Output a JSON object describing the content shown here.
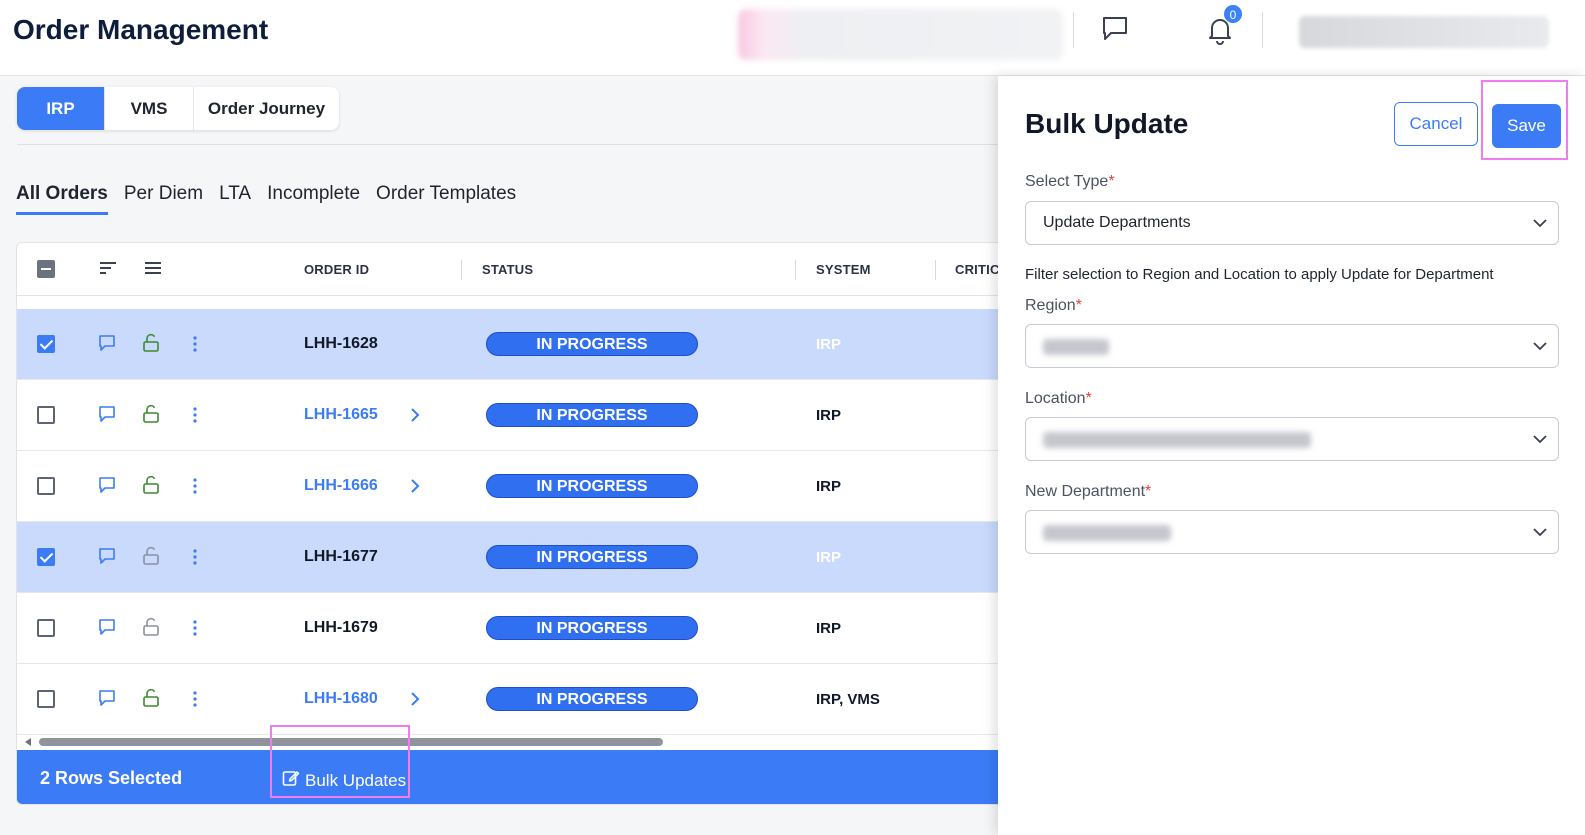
{
  "header": {
    "title": "Order Management",
    "notification_count": "0"
  },
  "segment_tabs": [
    {
      "label": "IRP",
      "active": true
    },
    {
      "label": "VMS",
      "active": false
    },
    {
      "label": "Order Journey",
      "active": false
    }
  ],
  "sub_tabs": [
    {
      "label": "All Orders",
      "active": true
    },
    {
      "label": "Per Diem",
      "active": false
    },
    {
      "label": "LTA",
      "active": false
    },
    {
      "label": "Incomplete",
      "active": false
    },
    {
      "label": "Order Templates",
      "active": false
    }
  ],
  "grid": {
    "columns": [
      "ORDER ID",
      "STATUS",
      "SYSTEM",
      "CRITIC."
    ],
    "rows": [
      {
        "order_id": "LHH-1628",
        "status": "IN PROGRESS",
        "system": "IRP",
        "selected": true,
        "link": false
      },
      {
        "order_id": "LHH-1665",
        "status": "IN PROGRESS",
        "system": "IRP",
        "selected": false,
        "link": true
      },
      {
        "order_id": "LHH-1666",
        "status": "IN PROGRESS",
        "system": "IRP",
        "selected": false,
        "link": true
      },
      {
        "order_id": "LHH-1677",
        "status": "IN PROGRESS",
        "system": "IRP",
        "selected": true,
        "link": false
      },
      {
        "order_id": "LHH-1679",
        "status": "IN PROGRESS",
        "system": "IRP",
        "selected": false,
        "link": false
      },
      {
        "order_id": "LHH-1680",
        "status": "IN PROGRESS",
        "system": "IRP, VMS",
        "selected": false,
        "link": true
      }
    ]
  },
  "footer": {
    "rows_selected": "2 Rows Selected",
    "bulk_updates": "Bulk Updates"
  },
  "panel": {
    "title": "Bulk Update",
    "cancel": "Cancel",
    "save": "Save",
    "select_type_label": "Select Type",
    "select_type_value": "Update Departments",
    "hint": "Filter selection to Region and Location to apply Update for Department",
    "region_label": "Region",
    "location_label": "Location",
    "new_department_label": "New Department",
    "required_mark": "*"
  },
  "colors": {
    "accent": "#3b7cf6",
    "selected_row": "#c9dafc",
    "highlight_box": "#f07cf0",
    "unlock_green": "#3a8a2e"
  }
}
